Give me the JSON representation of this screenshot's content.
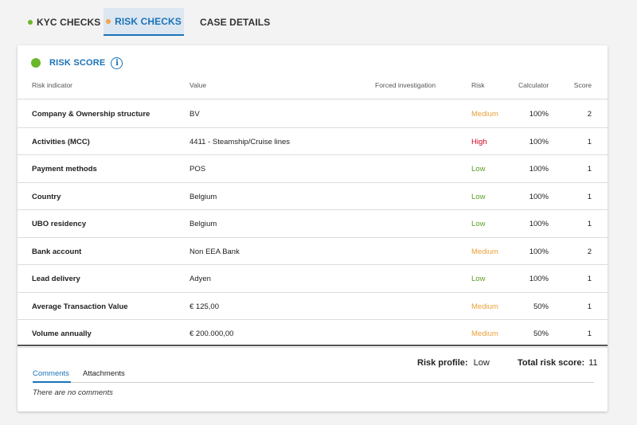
{
  "tabs": [
    {
      "label": "KYC CHECKS",
      "dot_color": "#6ab72a"
    },
    {
      "label": "RISK CHECKS",
      "dot_color": "#f5a24a"
    },
    {
      "label": "CASE DETAILS"
    }
  ],
  "card": {
    "title": "RISK SCORE",
    "status_color": "#6ab72a",
    "info_icon": "i"
  },
  "table": {
    "headers": [
      "Risk indicator",
      "Value",
      "Forced investigation",
      "Risk",
      "Calculator",
      "Score"
    ],
    "rows": [
      {
        "indicator": "Company & Ownership structure",
        "value": "BV",
        "forced": "",
        "risk": "Medium",
        "calculator": "100%",
        "score": "2"
      },
      {
        "indicator": "Activities (MCC)",
        "value": "4411 - Steamship/Cruise lines",
        "forced": "",
        "risk": "High",
        "calculator": "100%",
        "score": "1"
      },
      {
        "indicator": "Payment methods",
        "value": "POS",
        "forced": "",
        "risk": "Low",
        "calculator": "100%",
        "score": "1"
      },
      {
        "indicator": "Country",
        "value": "Belgium",
        "forced": "",
        "risk": "Low",
        "calculator": "100%",
        "score": "1"
      },
      {
        "indicator": "UBO residency",
        "value": "Belgium",
        "forced": "",
        "risk": "Low",
        "calculator": "100%",
        "score": "1"
      },
      {
        "indicator": "Bank account",
        "value": "Non EEA Bank",
        "forced": "",
        "risk": "Medium",
        "calculator": "100%",
        "score": "2"
      },
      {
        "indicator": "Lead delivery",
        "value": "Adyen",
        "forced": "",
        "risk": "Low",
        "calculator": "100%",
        "score": "1"
      },
      {
        "indicator": "Average Transaction Value",
        "value": "€ 125,00",
        "forced": "",
        "risk": "Medium",
        "calculator": "50%",
        "score": "1"
      },
      {
        "indicator": "Volume annually",
        "value": "€ 200.000,00",
        "forced": "",
        "risk": "Medium",
        "calculator": "50%",
        "score": "1"
      }
    ]
  },
  "summary": {
    "risk_profile_label": "Risk profile:",
    "risk_profile_value": "Low",
    "total_label": "Total risk score:",
    "total_value": "11"
  },
  "comments": {
    "tabs": [
      "Comments",
      "Attachments"
    ],
    "empty_text": "There are no comments"
  },
  "colors": {
    "accent": "#1a73b8",
    "medium": "#e8a13a",
    "high": "#d0021b",
    "low": "#5a9e25"
  }
}
